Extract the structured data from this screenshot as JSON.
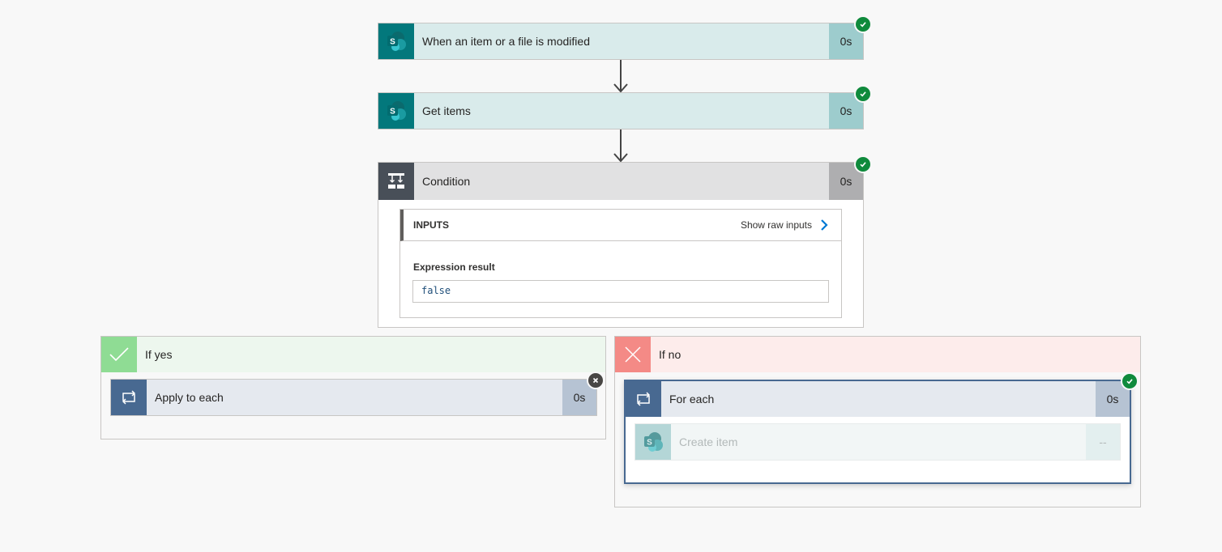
{
  "steps": [
    {
      "title": "When an item or a file is modified",
      "duration": "0s",
      "icon": "sharepoint-icon",
      "status": "succeeded"
    },
    {
      "title": "Get items",
      "duration": "0s",
      "icon": "sharepoint-icon",
      "status": "succeeded"
    },
    {
      "title": "Condition",
      "duration": "0s",
      "icon": "condition-icon",
      "status": "succeeded"
    }
  ],
  "condition": {
    "inputs_label": "INPUTS",
    "show_raw_label": "Show raw inputs",
    "expression_label": "Expression result",
    "expression_value": "false"
  },
  "branch_yes": {
    "label": "If yes",
    "action": {
      "title": "Apply to each",
      "duration": "0s",
      "icon": "loop-icon",
      "status": "skipped"
    }
  },
  "branch_no": {
    "label": "If no",
    "action": {
      "title": "For each",
      "duration": "0s",
      "icon": "loop-icon",
      "status": "succeeded"
    },
    "inner_action": {
      "title": "Create item",
      "duration": "--",
      "icon": "sharepoint-icon",
      "status": "not-run"
    }
  },
  "colors": {
    "sharepoint": "#03787c",
    "condition": "#484f58",
    "loop": "#486991",
    "success": "#0f8a3c",
    "yes_branch": "#edf7ee",
    "no_branch": "#fdeceb"
  }
}
